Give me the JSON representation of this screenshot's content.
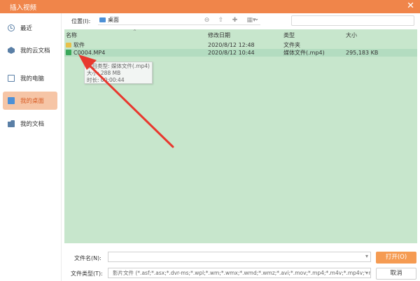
{
  "window": {
    "title": "插入视频",
    "close_glyph": "✕"
  },
  "sidebar": {
    "items": [
      {
        "label": "最近",
        "icon": "clock-icon",
        "active": false
      },
      {
        "label": "我的云文档",
        "icon": "cloud-icon",
        "active": false
      },
      {
        "label": "我的电脑",
        "icon": "computer-icon",
        "active": false
      },
      {
        "label": "我的桌面",
        "icon": "desktop-icon",
        "active": true
      },
      {
        "label": "我的文档",
        "icon": "documents-icon",
        "active": false
      }
    ]
  },
  "toolbar": {
    "location_label": "位置(I):",
    "location_value": "桌面",
    "dropdown_glyph": "⌄"
  },
  "file_list": {
    "columns": [
      "名称",
      "修改日期",
      "类型",
      "大小"
    ],
    "rows": [
      {
        "name": "软件",
        "modified": "2020/8/12 12:48",
        "type": "文件夹",
        "size": "",
        "icon": "folder-icon"
      },
      {
        "name": "C0004.MP4",
        "modified": "2020/8/12 10:44",
        "type": "媒体文件(.mp4)",
        "size": "295,183 KB",
        "icon": "video-file-icon",
        "selected": true
      }
    ],
    "tooltip": {
      "line1": "项目类型: 媒体文件(.mp4)",
      "line2": "大小: 288 MB",
      "line3": "时长: 00:00:44"
    }
  },
  "bottom": {
    "filename_label": "文件名(N):",
    "filename_value": "",
    "filetype_label": "文件类型(T):",
    "filetype_value": "影片文件 (*.asf;*.asx;*.dvr-ms;*.wpl;*.wm;*.wmx;*.wmd;*.wmz;*.avi;*.mov;*.mp4;*.m4v;*.mp4v;*.r",
    "open_button": "打开(O)",
    "cancel_button": "取消"
  },
  "colors": {
    "accent": "#f0854a",
    "list_background": "#c7e6cc",
    "annotation_arrow": "#e8382e"
  }
}
